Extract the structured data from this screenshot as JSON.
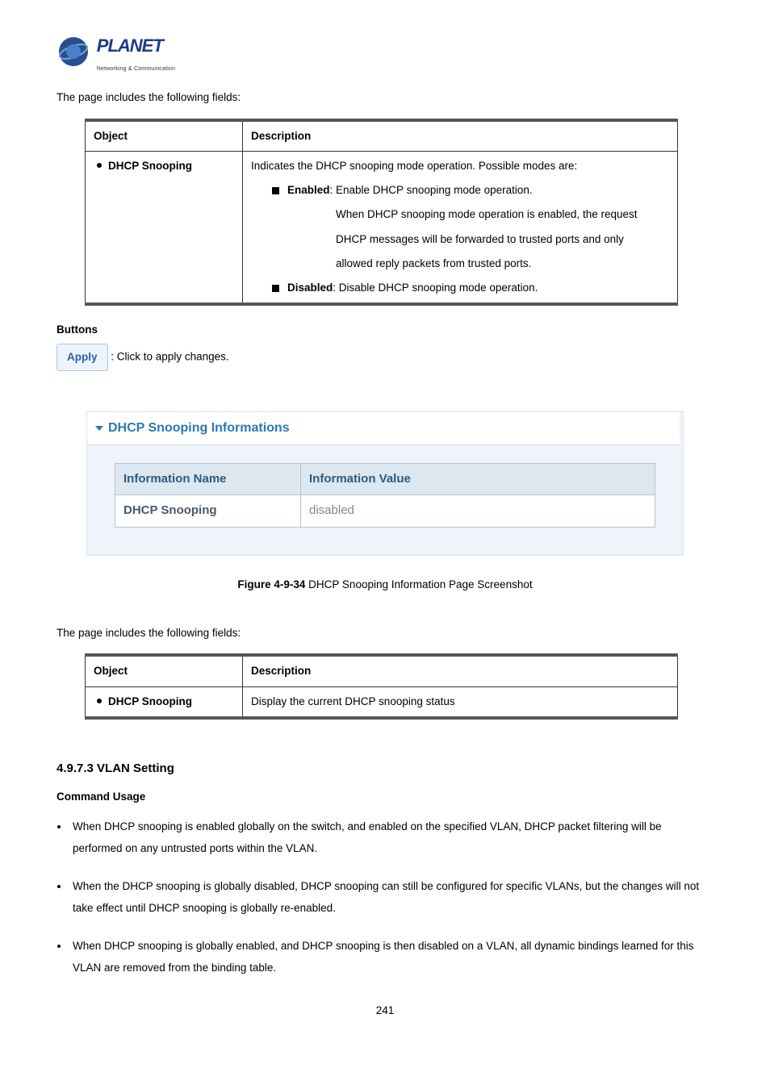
{
  "logo": {
    "brand": "PLANET",
    "tagline": "Networking & Communication"
  },
  "intro1": "The page includes the following fields:",
  "table1": {
    "head_object": "Object",
    "head_description": "Description",
    "row_object": "DHCP Snooping",
    "row_desc_line1": "Indicates the DHCP snooping mode operation. Possible modes are:",
    "row_desc_enabled_label": "Enabled",
    "row_desc_enabled_text": ": Enable DHCP snooping mode operation.",
    "row_desc_enabled_sub1": "When DHCP snooping mode operation is enabled, the request",
    "row_desc_enabled_sub2": "DHCP messages will be forwarded to trusted ports and only",
    "row_desc_enabled_sub3": "allowed reply packets from trusted ports.",
    "row_desc_disabled_label": "Disabled",
    "row_desc_disabled_text": ": Disable DHCP snooping mode operation."
  },
  "buttons_heading": "Buttons",
  "apply_label": "Apply",
  "apply_desc": ": Click to apply changes.",
  "panel": {
    "title": "DHCP Snooping Informations",
    "col_name": "Information Name",
    "col_value": "Information Value",
    "row_name": "DHCP Snooping",
    "row_value": "disabled"
  },
  "figure_caption_bold": "Figure 4-9-34",
  "figure_caption_rest": " DHCP Snooping Information Page Screenshot",
  "intro2": "The page includes the following fields:",
  "table2": {
    "head_object": "Object",
    "head_description": "Description",
    "row_object": "DHCP Snooping",
    "row_desc": "Display the current DHCP snooping status"
  },
  "section_heading": "4.9.7.3 VLAN Setting",
  "command_usage": "Command Usage",
  "cmd_items": [
    "When DHCP snooping is enabled globally on the switch, and enabled on the specified VLAN, DHCP packet filtering will be performed on any untrusted ports within the VLAN.",
    "When the DHCP snooping is globally disabled, DHCP snooping can still be configured for specific VLANs, but the changes will not take effect until DHCP snooping is globally re-enabled.",
    "When DHCP snooping is globally enabled, and DHCP snooping is then disabled on a VLAN, all dynamic bindings learned for this VLAN are removed from the binding table."
  ],
  "page_number": "241"
}
